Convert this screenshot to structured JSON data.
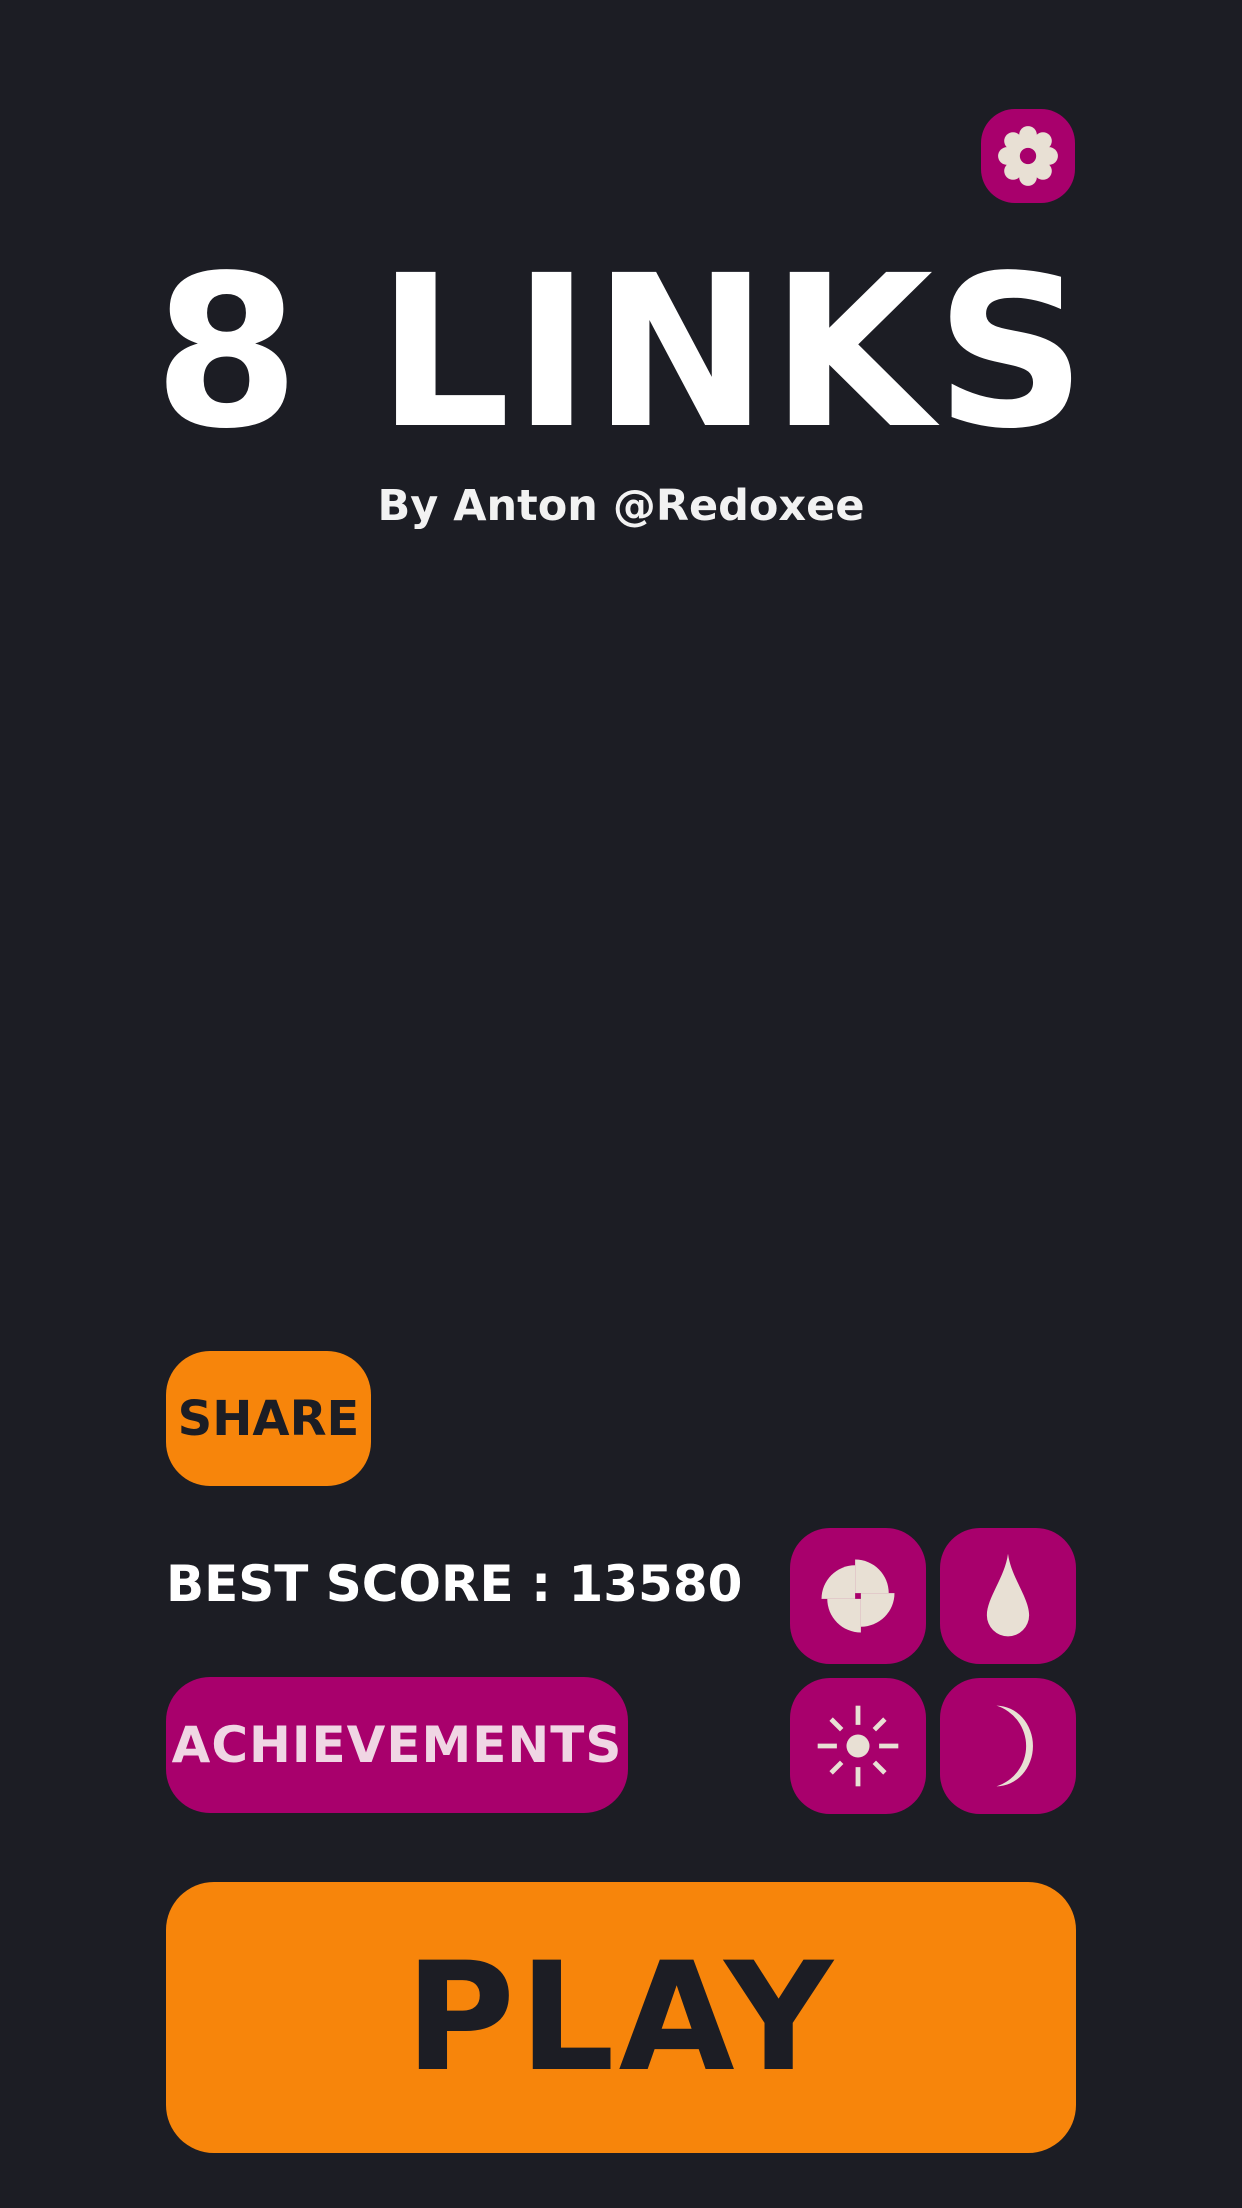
{
  "game": {
    "title": "8 LINKS",
    "subtitle": "By Anton @Redoxee"
  },
  "buttons": {
    "share_label": "SHARE",
    "achievements_label": "ACHIEVEMENTS",
    "play_label": "PLAY",
    "settings_icon": "gear-icon"
  },
  "score": {
    "best_label": "BEST SCORE : 13580"
  },
  "themes": [
    {
      "icon": "pinwheel-icon"
    },
    {
      "icon": "drop-icon"
    },
    {
      "icon": "sun-icon"
    },
    {
      "icon": "moon-icon"
    }
  ],
  "colors": {
    "background": "#1c1d24",
    "accent_magenta": "#a8006c",
    "accent_orange": "#f7850b",
    "icon_cream": "#e8e0d4"
  }
}
